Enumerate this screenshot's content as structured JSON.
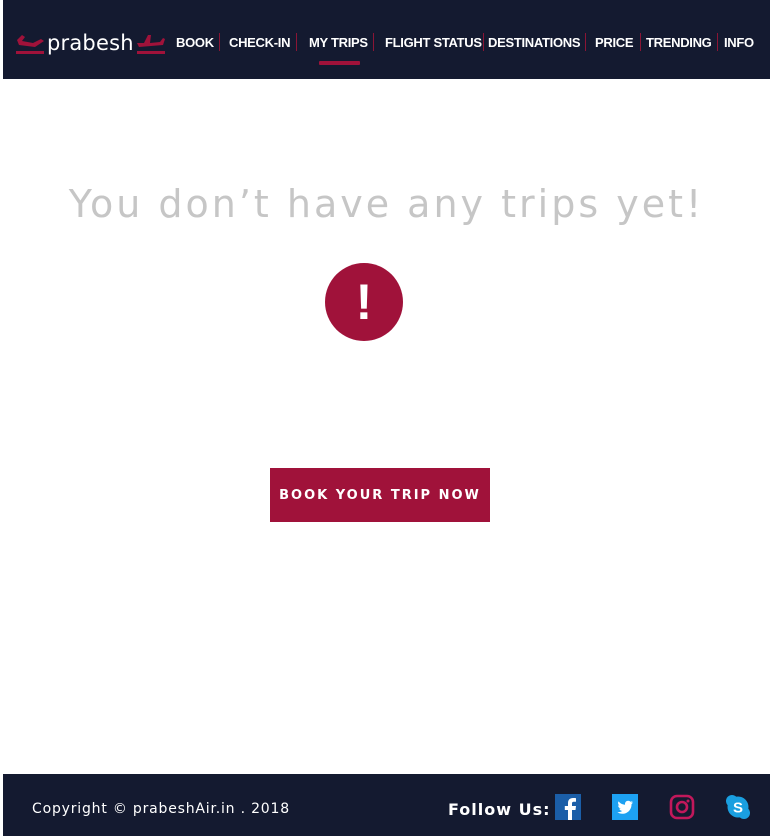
{
  "brand": {
    "name": "prabesh"
  },
  "nav": {
    "items": [
      {
        "label": "BOOK"
      },
      {
        "label": "CHECK-IN"
      },
      {
        "label": "MY TRIPS"
      },
      {
        "label": "FLIGHT STATUS"
      },
      {
        "label": "DESTINATIONS"
      },
      {
        "label": "PRICE"
      },
      {
        "label": "TRENDING"
      },
      {
        "label": "INFO"
      }
    ],
    "active": "MY TRIPS"
  },
  "main": {
    "empty_message": "You don’t have any trips yet!",
    "alert_icon": "exclamation-circle-icon",
    "alert_glyph": "!",
    "cta_label": "BOOK YOUR TRIP NOW"
  },
  "footer": {
    "copyright": "Copyright © prabeshAir.in . 2018",
    "follow_label": "Follow Us:",
    "social": [
      {
        "name": "facebook-icon",
        "color": "#1b5ea8"
      },
      {
        "name": "twitter-icon",
        "color": "#1da1f2"
      },
      {
        "name": "instagram-icon",
        "color": "#c2185b"
      },
      {
        "name": "skype-icon",
        "color": "#1a9fe0"
      }
    ]
  },
  "colors": {
    "header_bg": "#141a30",
    "accent": "#a0123a",
    "empty_text": "#c6c6c6"
  }
}
